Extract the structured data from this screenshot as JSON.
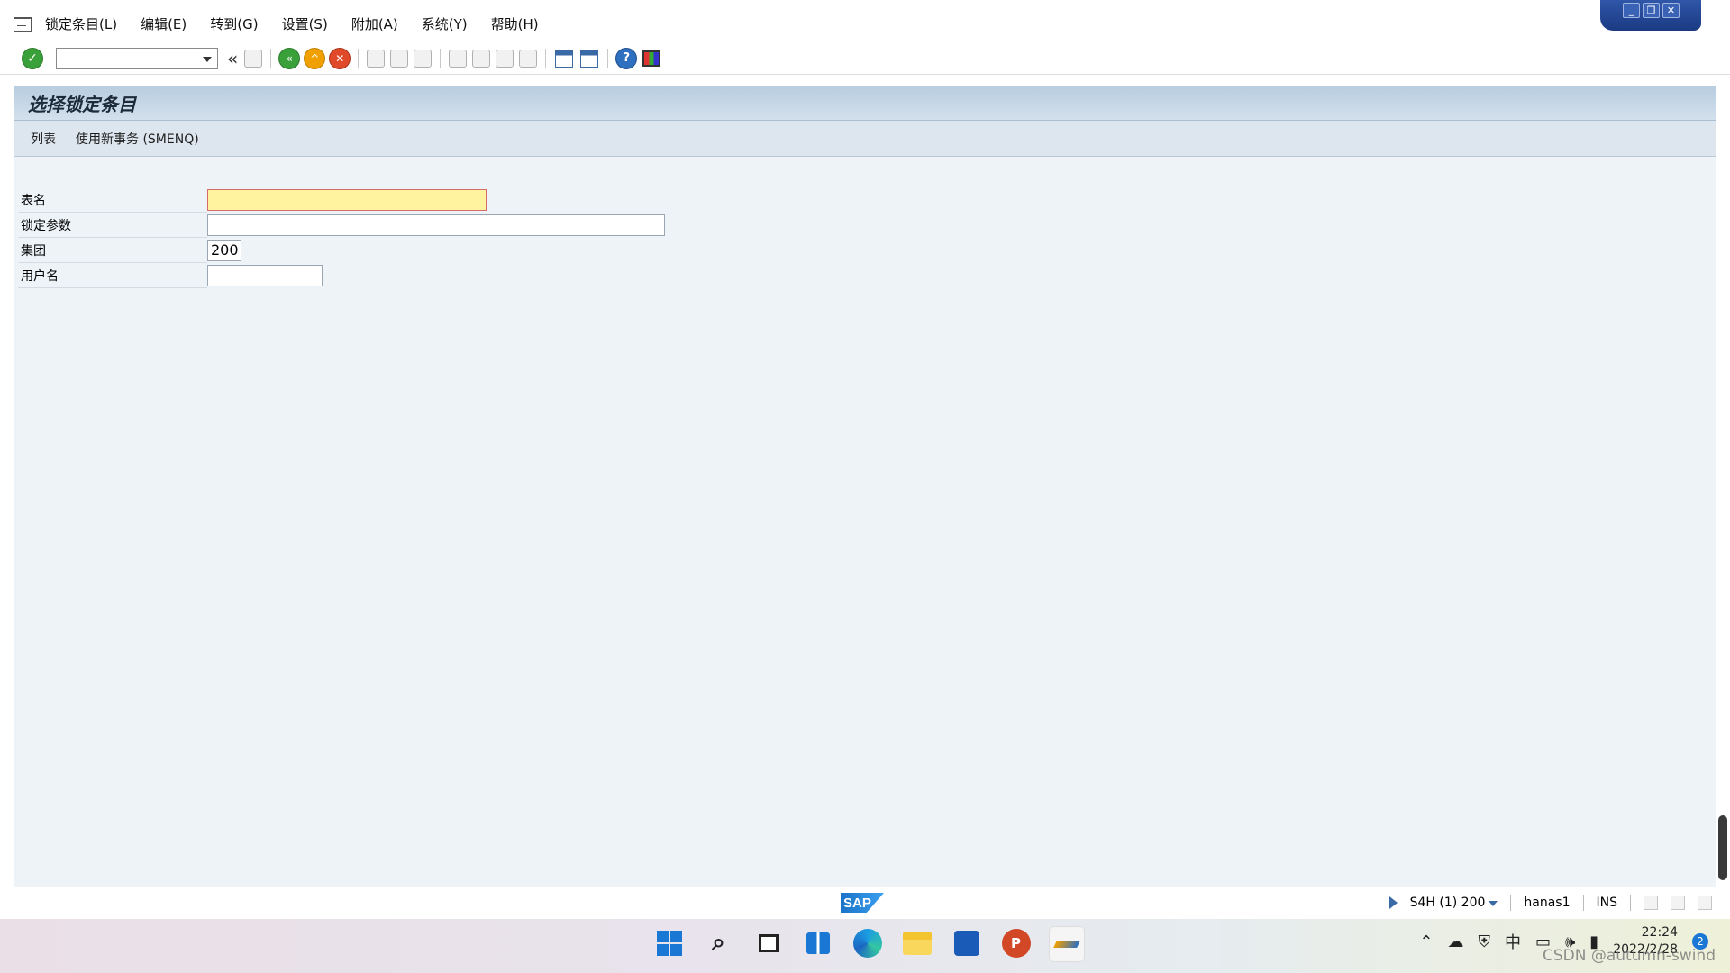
{
  "menubar": {
    "items": [
      "锁定条目(L)",
      "编辑(E)",
      "转到(G)",
      "设置(S)",
      "附加(A)",
      "系统(Y)",
      "帮助(H)"
    ]
  },
  "toolbar": {
    "command_field_value": ""
  },
  "screen": {
    "title": "选择锁定条目",
    "app_toolbar": [
      "列表",
      "使用新事务 (SMENQ)"
    ]
  },
  "form": {
    "table_name": {
      "label": "表名",
      "value": ""
    },
    "lock_argument": {
      "label": "锁定参数",
      "value": ""
    },
    "client": {
      "label": "集团",
      "value": "200"
    },
    "user_name": {
      "label": "用户名",
      "value": ""
    }
  },
  "statusbar": {
    "logo": "SAP",
    "system": "S4H (1) 200",
    "server": "hanas1",
    "mode": "INS"
  },
  "taskbar": {
    "tray_ime": "中",
    "time": "22:24",
    "date": "2022/2/28",
    "notifications": "2"
  },
  "watermark": "CSDN @autumn-swind",
  "colors": {
    "required_field": "#fff3a0",
    "title_bar": "#b8cde0",
    "work_area": "#eef3f8"
  }
}
